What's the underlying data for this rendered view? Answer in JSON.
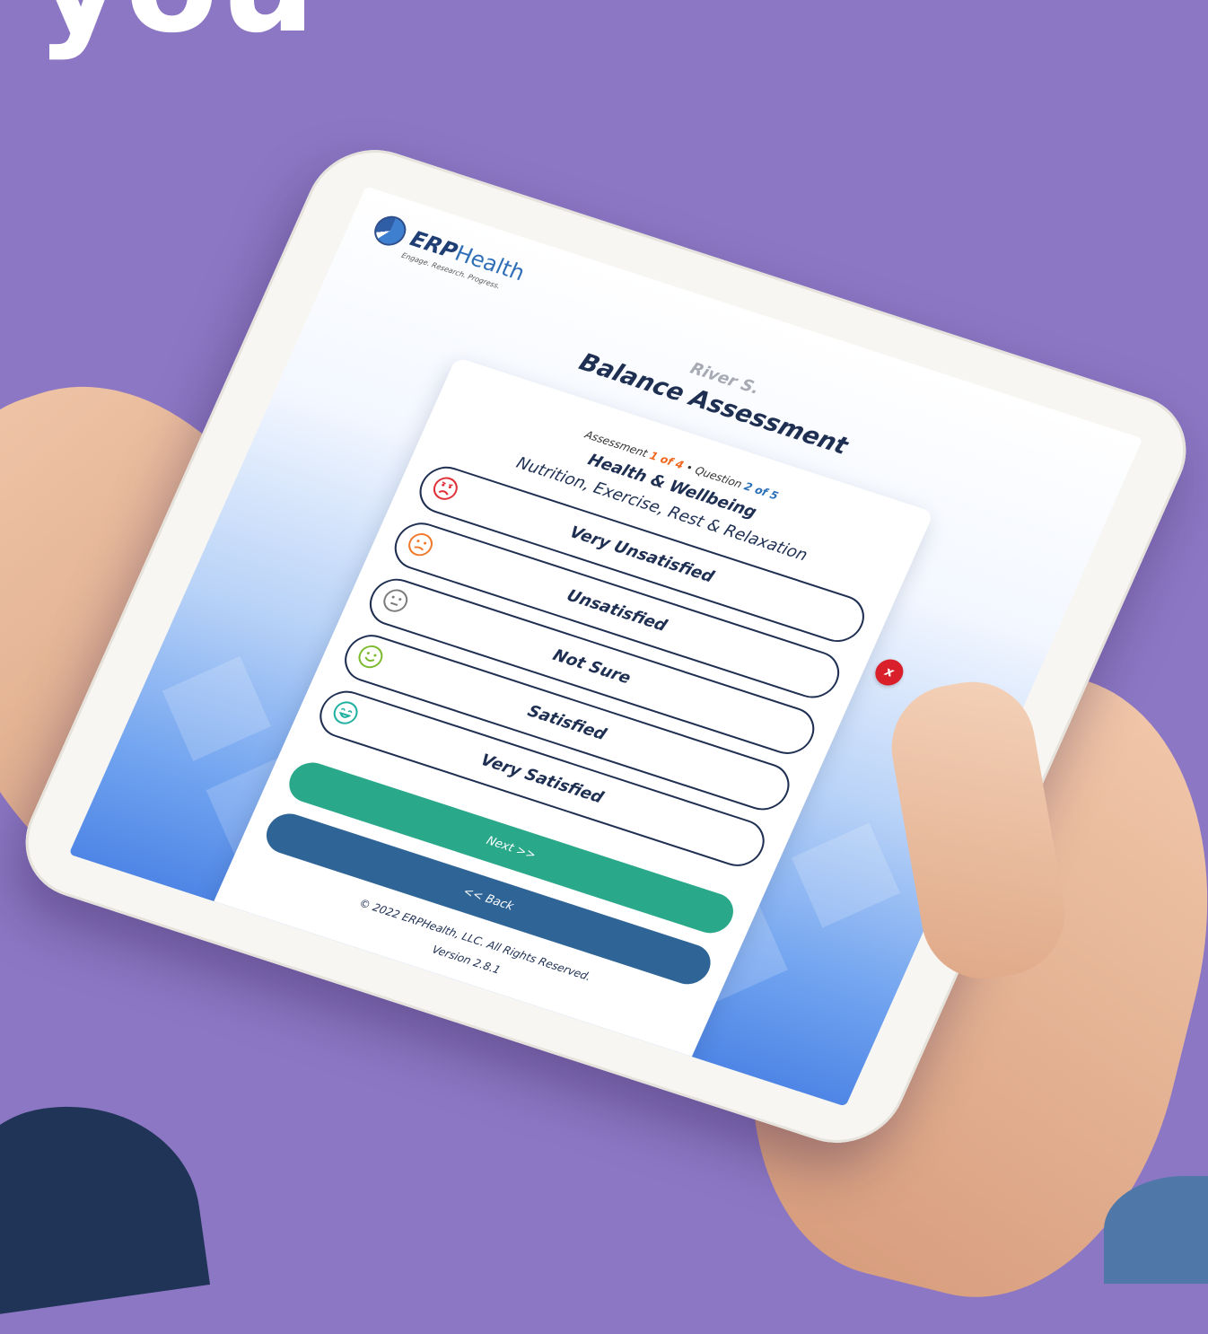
{
  "background": {
    "headline": "you",
    "color": "#8c77c4"
  },
  "app": {
    "logo_brand": "ERP",
    "logo_name": "Health",
    "logo_tagline": "Engage. Research. Progress.",
    "user_name": "River S.",
    "assessment_title": "Balance Assessment",
    "close_label": "x"
  },
  "progress": {
    "assessment_prefix": "Assessment",
    "assessment_value": "1 of 4",
    "separator": "•",
    "question_prefix": "Question",
    "question_value": "2 of 5"
  },
  "question": {
    "category": "Health & Wellbeing",
    "subcategory": "Nutrition, Exercise, Rest & Relaxation"
  },
  "options": [
    {
      "label": "Very Unsatisfied",
      "icon": "very-unsatisfied-face-icon",
      "color": "#e0303a"
    },
    {
      "label": "Unsatisfied",
      "icon": "unsatisfied-face-icon",
      "color": "#f07a2b"
    },
    {
      "label": "Not Sure",
      "icon": "neutral-face-icon",
      "color": "#7d7d7d"
    },
    {
      "label": "Satisfied",
      "icon": "satisfied-face-icon",
      "color": "#7dbb2e"
    },
    {
      "label": "Very Satisfied",
      "icon": "very-satisfied-face-icon",
      "color": "#1fb0a0"
    }
  ],
  "buttons": {
    "next": "Next >>",
    "back": "<< Back"
  },
  "footer": {
    "copyright": "© 2022 ERPHealth, LLC. All Rights Reserved.",
    "version": "Version 2.8.1"
  },
  "colors": {
    "primary_text": "#1e2f52",
    "next_button": "#2aa88a",
    "back_button": "#2f6496",
    "close_button": "#d81f2a",
    "assessment_highlight": "#f0661d",
    "question_highlight": "#2a6fb8"
  }
}
